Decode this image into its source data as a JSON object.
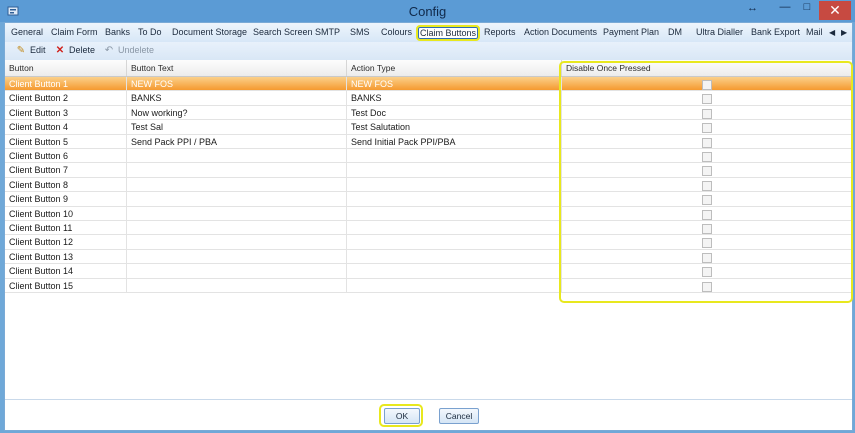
{
  "window": {
    "title": "Config",
    "resize_glyph": "↔",
    "minimize_glyph": "—",
    "maximize_glyph": "□",
    "close_glyph": "✕"
  },
  "tabs": [
    {
      "label": "General"
    },
    {
      "label": "Claim Form"
    },
    {
      "label": "Banks"
    },
    {
      "label": "To Do"
    },
    {
      "label": "Document Storage"
    },
    {
      "label": "Search Screen"
    },
    {
      "label": "SMTP"
    },
    {
      "label": "SMS"
    },
    {
      "label": "Colours"
    },
    {
      "label": "Claim Buttons"
    },
    {
      "label": "Reports"
    },
    {
      "label": "Action Documents"
    },
    {
      "label": "Payment Plan"
    },
    {
      "label": "DM"
    },
    {
      "label": "Ultra Dialler"
    },
    {
      "label": "Bank Export"
    },
    {
      "label": "Mail"
    }
  ],
  "active_tab": "Claim Buttons",
  "toolbar": {
    "edit": "Edit",
    "delete": "Delete",
    "undelete": "Undelete"
  },
  "grid": {
    "columns": [
      "Button",
      "Button Text",
      "Action Type",
      "Disable Once Pressed"
    ],
    "rows": [
      {
        "button": "Client Button 1",
        "text": "NEW FOS",
        "action": "NEW FOS",
        "disable": false
      },
      {
        "button": "Client Button 2",
        "text": "BANKS",
        "action": "BANKS",
        "disable": false
      },
      {
        "button": "Client Button 3",
        "text": "Now working?",
        "action": "Test Doc",
        "disable": false
      },
      {
        "button": "Client Button 4",
        "text": "Test Sal",
        "action": "Test Salutation",
        "disable": false
      },
      {
        "button": "Client Button 5",
        "text": "Send Pack PPI / PBA",
        "action": "Send Initial Pack PPI/PBA",
        "disable": false
      },
      {
        "button": "Client Button 6",
        "text": "",
        "action": "",
        "disable": false
      },
      {
        "button": "Client Button 7",
        "text": "",
        "action": "",
        "disable": false
      },
      {
        "button": "Client Button 8",
        "text": "",
        "action": "",
        "disable": false
      },
      {
        "button": "Client Button 9",
        "text": "",
        "action": "",
        "disable": false
      },
      {
        "button": "Client Button 10",
        "text": "",
        "action": "",
        "disable": false
      },
      {
        "button": "Client Button 11",
        "text": "",
        "action": "",
        "disable": false
      },
      {
        "button": "Client Button 12",
        "text": "",
        "action": "",
        "disable": false
      },
      {
        "button": "Client Button 13",
        "text": "",
        "action": "",
        "disable": false
      },
      {
        "button": "Client Button 14",
        "text": "",
        "action": "",
        "disable": false
      },
      {
        "button": "Client Button 15",
        "text": "",
        "action": "",
        "disable": false
      }
    ]
  },
  "footer": {
    "ok": "OK",
    "cancel": "Cancel"
  },
  "colors": {
    "highlight": "#e8e81e",
    "selected_row": "#f59a2f",
    "title_bar": "#5b9bd5",
    "close_button": "#c74a41"
  }
}
